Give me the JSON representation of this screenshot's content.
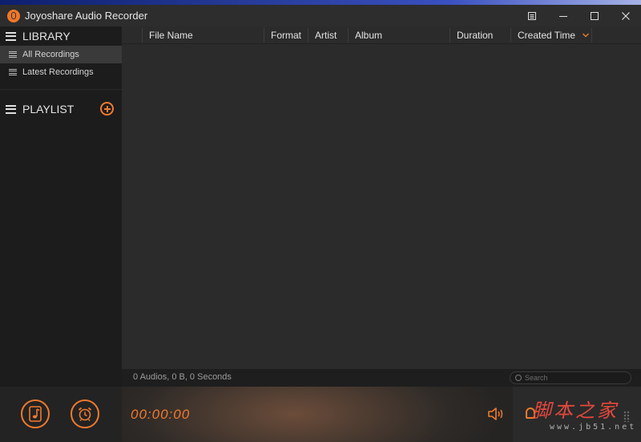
{
  "window": {
    "title": "Joyoshare Audio Recorder",
    "controls": [
      "menu-icon",
      "minimize-icon",
      "maximize-icon",
      "close-icon"
    ]
  },
  "sidebar": {
    "library_label": "LIBRARY",
    "items": [
      {
        "label": "All Recordings",
        "active": true
      },
      {
        "label": "Latest Recordings",
        "active": false
      }
    ],
    "playlist_label": "PLAYLIST"
  },
  "table": {
    "columns": [
      "File Name",
      "Format",
      "Artist",
      "Album",
      "Duration",
      "Created Time"
    ],
    "sort_column": "Created Time",
    "rows": []
  },
  "status": {
    "summary": "0 Audios, 0 B, 0 Seconds",
    "search_placeholder": "Search"
  },
  "player": {
    "time": "00:00:00"
  },
  "watermark": {
    "main": "脚本之家",
    "sub": "www.jb51.net"
  },
  "colors": {
    "accent": "#ef7a2e",
    "background": "#2b2b2b",
    "sidebar": "#1c1c1c",
    "watermark": "#e5483c"
  },
  "icons": {
    "app": "joyoshare-logo-icon",
    "library": "hamburger-icon",
    "list_item": "list-icon",
    "add_playlist": "add-circle-icon",
    "music": "music-note-icon",
    "schedule": "alarm-clock-icon",
    "volume": "volume-icon",
    "search": "search-icon"
  }
}
